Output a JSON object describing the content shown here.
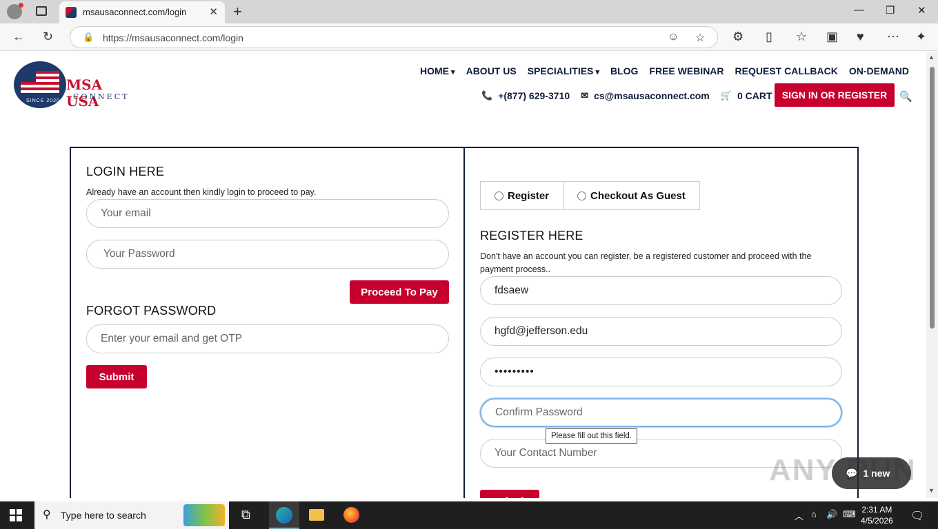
{
  "browser": {
    "tab_title": "msausaconnect.com/login",
    "url": "https://msausaconnect.com/login"
  },
  "site": {
    "logo_name": "MSA USA",
    "logo_sub": "CONNECT",
    "logo_since": "SINCE 2020",
    "menu": [
      "HOME",
      "ABOUT US",
      "SPECIALITIES",
      "BLOG",
      "FREE WEBINAR",
      "REQUEST CALLBACK",
      "ON-DEMAND"
    ],
    "phone": "+(877) 629-3710",
    "email": "cs@msausaconnect.com",
    "cart": "0 CART",
    "signin_label": "SIGN IN OR REGISTER"
  },
  "login": {
    "title": "LOGIN HERE",
    "desc": "Already have an account then kindly login to proceed to pay.",
    "email_placeholder": "Your email",
    "password_placeholder": "Your Password",
    "proceed_label": "Proceed To Pay"
  },
  "forgot": {
    "title": "FORGOT PASSWORD",
    "email_placeholder": "Enter your email and get OTP",
    "submit_label": "Submit"
  },
  "register": {
    "option_register": "Register",
    "option_guest": "Checkout As Guest",
    "title": "REGISTER HERE",
    "desc": "Don't have an account you can register, be a registered customer and proceed with the payment process..",
    "name_value": "fdsaew",
    "email_value": "hgfd@jefferson.edu",
    "password_value": "•••••••••",
    "confirm_placeholder": "Confirm Password",
    "contact_placeholder": "Your Contact Number",
    "tooltip": "Please fill out this field.",
    "submit_label": "Submit"
  },
  "overlay": {
    "chat_label": "1 new",
    "watermark": "ANY RUN"
  },
  "taskbar": {
    "search_placeholder": "Type here to search",
    "time": "2:31 AM",
    "date": "4/5/2026"
  }
}
